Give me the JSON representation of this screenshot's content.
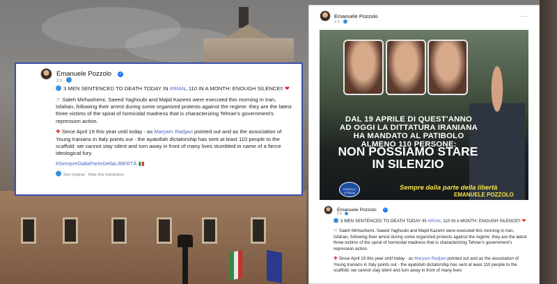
{
  "post": {
    "author": "Emanuele Pozzolo",
    "time_left": "2 h",
    "time_right": "2 h",
    "time_right_small": "3 h",
    "headline_prefix": "3 MEN SENTENCED TO DEATH TODAY IN",
    "headline_hashtag": "#IRAN",
    "headline_suffix": ", 110 IN A MONTH: ENOUGH SILENCE!!",
    "para1": "Saleh Mirhashemi, Saeed Yaghoubi and Majid Kazemi were executed this morning in Iran, Isfahan, following their arrest during some organized protests against the regime: they are the latest three victims of the spiral of homicidal madness that is characterizing Tehran's government's repression action.",
    "para2_prefix": "Since April 19 this year until today - as",
    "para2_mention": "Maryam Radjavi",
    "para2_mid": "pointed out and as the association of Young Iranians in Italy points out - the ayatollah dictatorship has sent at least 110 people to the scaffold: we cannot stay silent and turn away in front of many lives stumbled in name of a fierce ideological fury.",
    "para2_mid_cut": "pointed out and as the association of Young Iranians in Italy points out - the ayatollah dictatorship has sent at least 110 people to the scaffold: we cannot stay silent and turn away in front of many lives",
    "hashtag_footer": "#SempreDallaParteDellaLIBERTÀ",
    "see_original": "See original · Rate this translation"
  },
  "media": {
    "subtitle": "DAL 19 APRILE DI QUEST'ANNO AD OGGI LA DITTATURA IRANIANA HA MANDATO AL PATIBOLO ALMENO 110 PERSONE:",
    "main": "NON POSSIAMO STARE IN SILENZIO",
    "tagline": "Sempre dalla parte della libertà",
    "signature": "EMANUELE POZZOLO",
    "logo_text": "FRATELLI D'ITALIA"
  },
  "colors": {
    "accent": "#4a67c7",
    "frame": "#3a4fae",
    "verified": "#1877f2",
    "tagline": "#f6e34a"
  },
  "icons": {
    "verified": "verified-badge-icon",
    "globe": "globe-icon",
    "more": "more-options-icon"
  }
}
